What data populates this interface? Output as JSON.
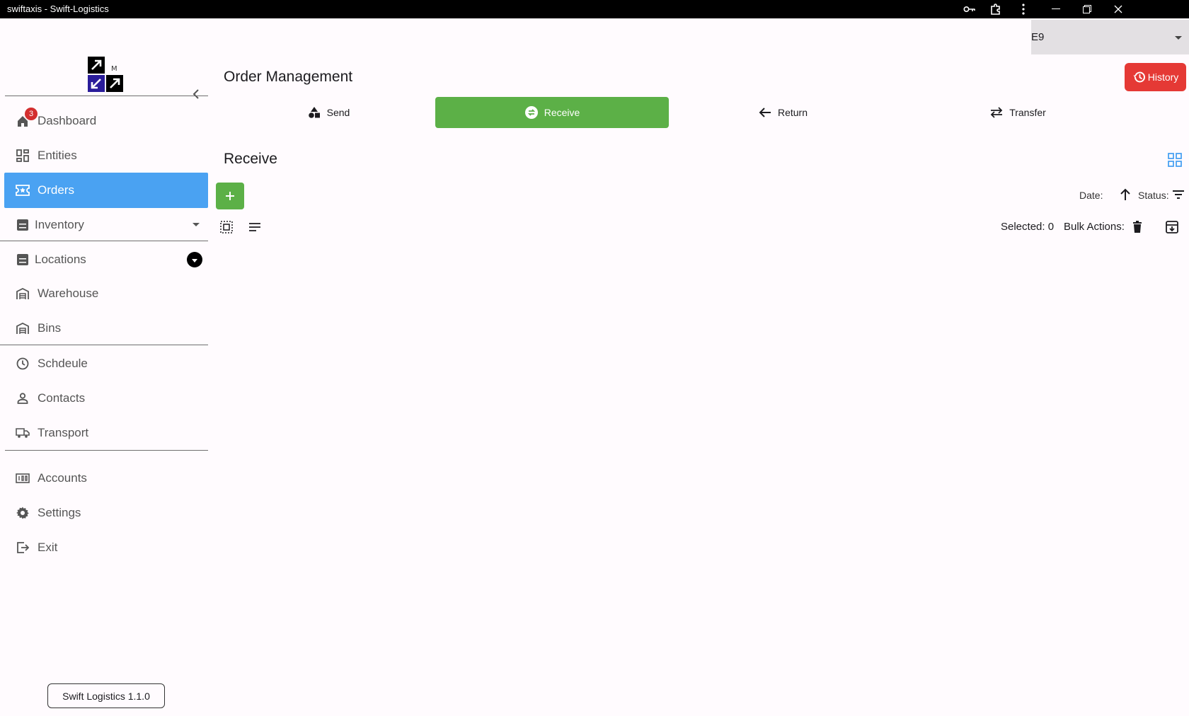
{
  "window": {
    "title": "swiftaxis - Swift-Logistics"
  },
  "top_select": {
    "value": "E9"
  },
  "sidebar": {
    "dashboard_badge": "3",
    "items": [
      {
        "label": "Dashboard",
        "icon": "home-icon"
      },
      {
        "label": "Entities",
        "icon": "dashboard-grid-icon"
      },
      {
        "label": "Orders",
        "icon": "ticket-icon"
      },
      {
        "label": "Inventory",
        "icon": "inventory-icon"
      },
      {
        "label": "Locations",
        "icon": "inventory-icon"
      },
      {
        "label": "Warehouse",
        "icon": "warehouse-icon"
      },
      {
        "label": "Bins",
        "icon": "warehouse-icon"
      },
      {
        "label": "Schdeule",
        "icon": "clock-icon"
      },
      {
        "label": "Contacts",
        "icon": "person-icon"
      },
      {
        "label": "Transport",
        "icon": "truck-icon"
      },
      {
        "label": "Accounts",
        "icon": "counter-icon"
      },
      {
        "label": "Settings",
        "icon": "gear-icon"
      },
      {
        "label": "Exit",
        "icon": "exit-icon"
      }
    ],
    "version": "Swift Logistics 1.1.0"
  },
  "header": {
    "title": "Order Management",
    "history_label": "History"
  },
  "tabs": [
    {
      "label": "Send",
      "icon": "shapes-icon"
    },
    {
      "label": "Receive",
      "icon": "swap-circle-icon",
      "active": true
    },
    {
      "label": "Return",
      "icon": "arrow-left-icon"
    },
    {
      "label": "Transfer",
      "icon": "transfer-icon"
    }
  ],
  "section": {
    "title": "Receive",
    "date_label": "Date:",
    "status_label": "Status:",
    "selected_label": "Selected: 0",
    "bulk_actions_label": "Bulk Actions:"
  },
  "colors": {
    "accent_blue": "#4aa2f2",
    "accent_green": "#5cb047",
    "danger_red": "#e53935"
  }
}
